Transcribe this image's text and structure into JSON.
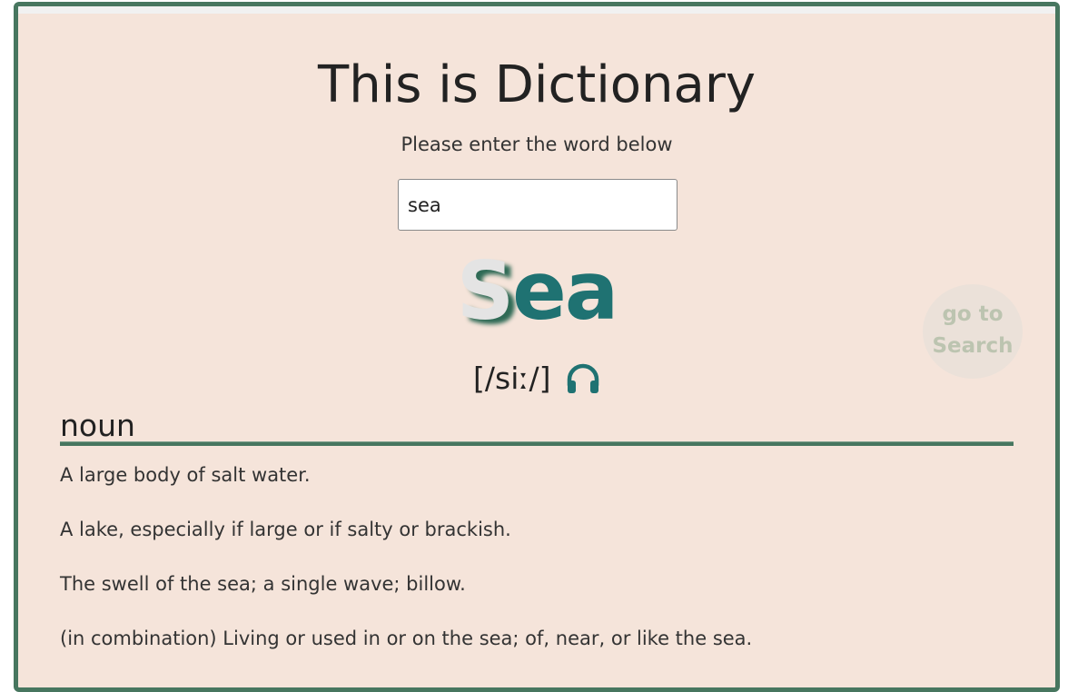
{
  "header": {
    "title": "This is Dictionary",
    "subtitle": "Please enter the word below"
  },
  "search": {
    "value": "sea"
  },
  "word": {
    "first_letter": "S",
    "rest": "ea",
    "pronunciation": "[/siː/]",
    "audio_icon": "headphones-icon"
  },
  "goto_button": {
    "line1": "go to",
    "line2": "Search"
  },
  "meanings": [
    {
      "part_of_speech": "noun",
      "definitions": [
        "A large body of salt water.",
        "A lake, especially if large or if salty or brackish.",
        "The swell of the sea; a single wave; billow.",
        "(in combination) Living or used in or on the sea; of, near, or like the sea."
      ]
    }
  ],
  "colors": {
    "frame_border": "#47765f",
    "background": "#f5e4da",
    "accent": "#1f7272"
  }
}
